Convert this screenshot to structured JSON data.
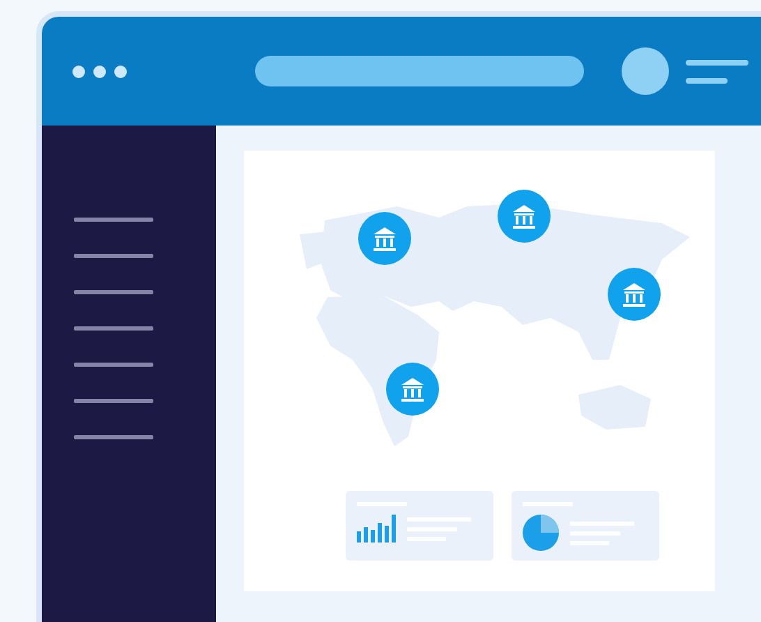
{
  "sidebar": {
    "items": [
      {
        "kind": "line"
      },
      {
        "kind": "line"
      },
      {
        "kind": "line"
      },
      {
        "kind": "line"
      },
      {
        "kind": "line"
      },
      {
        "kind": "line"
      },
      {
        "kind": "line"
      }
    ]
  },
  "map": {
    "markers": [
      {
        "kind": "bank"
      },
      {
        "kind": "bank"
      },
      {
        "kind": "bank"
      },
      {
        "kind": "bank"
      }
    ]
  },
  "widgets": [
    {
      "kind": "bar-chart"
    },
    {
      "kind": "pie-chart"
    }
  ]
}
